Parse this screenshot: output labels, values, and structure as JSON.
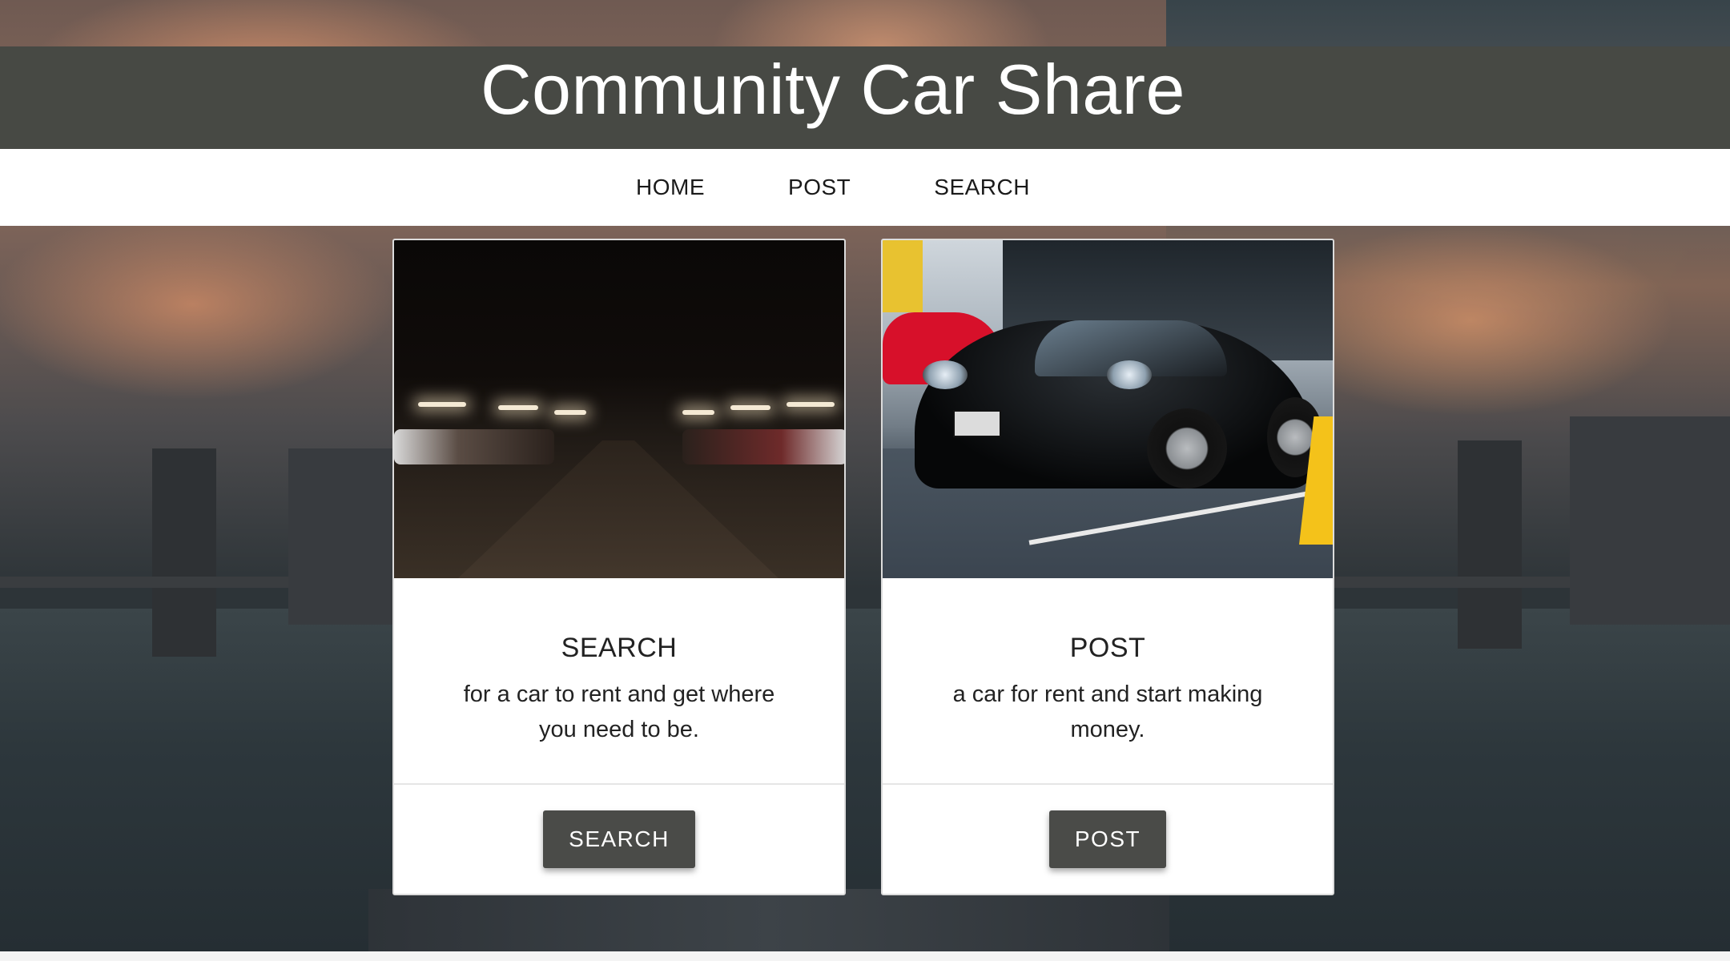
{
  "site": {
    "title": "Community Car Share"
  },
  "nav": {
    "items": [
      {
        "label": "HOME"
      },
      {
        "label": "POST"
      },
      {
        "label": "SEARCH"
      }
    ]
  },
  "cards": [
    {
      "image": "parking-garage-photo",
      "title": "SEARCH",
      "text": "for a car to rent and get where you need to be.",
      "button": "SEARCH"
    },
    {
      "image": "black-sports-car-photo",
      "title": "POST",
      "text": "a car for rent and start making money.",
      "button": "POST"
    }
  ],
  "colors": {
    "header_bg": "#474944",
    "nav_bg": "#ffffff",
    "button_bg": "#4a4b48",
    "card_bg": "#ffffff"
  }
}
